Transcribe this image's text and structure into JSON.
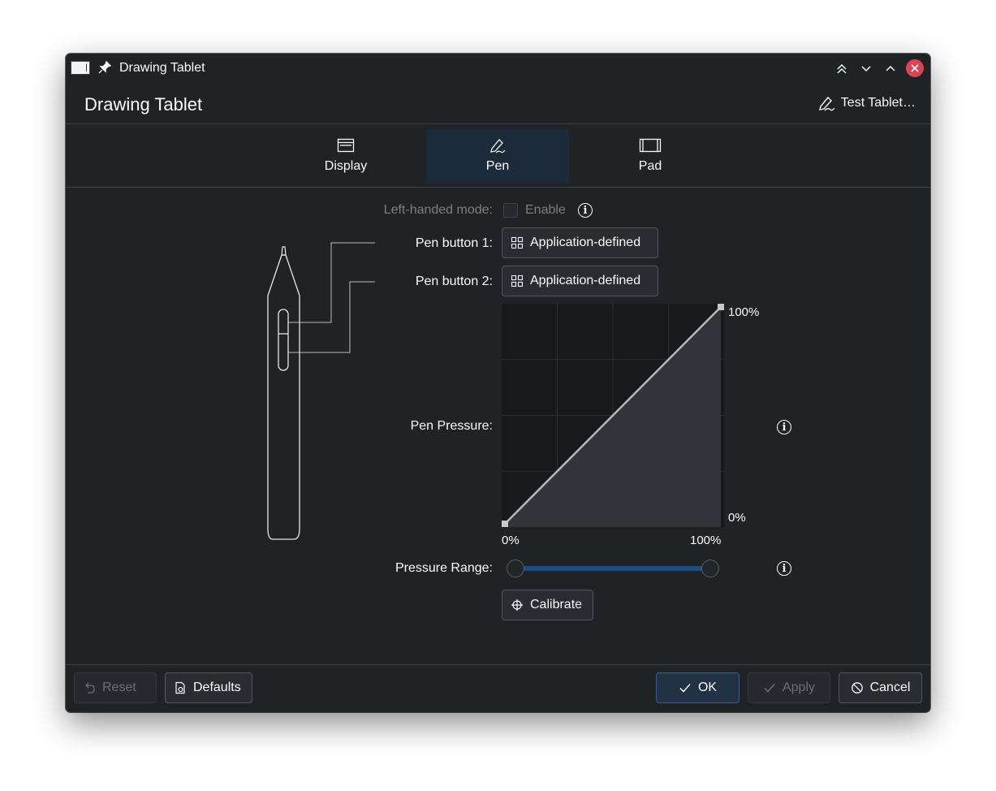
{
  "titlebar": {
    "title": "Drawing Tablet"
  },
  "header": {
    "page_title": "Drawing Tablet",
    "test_button": "Test Tablet…"
  },
  "tabs": [
    {
      "label": "Display",
      "icon": "display-icon"
    },
    {
      "label": "Pen",
      "icon": "pen-icon",
      "active": true
    },
    {
      "label": "Pad",
      "icon": "pad-icon"
    }
  ],
  "pen": {
    "left_handed_label": "Left-handed mode:",
    "left_handed_checkbox": "Enable",
    "button1_label": "Pen button 1:",
    "button1_value": "Application-defined",
    "button2_label": "Pen button 2:",
    "button2_value": "Application-defined",
    "pressure_label": "Pen Pressure:",
    "pressure_curve": {
      "x_min": "0%",
      "x_max": "100%",
      "y_min": "0%",
      "y_max": "100%",
      "points": [
        [
          0,
          0
        ],
        [
          1,
          1
        ]
      ]
    },
    "range_label": "Pressure Range:",
    "range_values": [
      0,
      1
    ],
    "calibrate": "Calibrate"
  },
  "footer": {
    "reset": "Reset",
    "defaults": "Defaults",
    "ok": "OK",
    "apply": "Apply",
    "cancel": "Cancel"
  },
  "colors": {
    "accent": "#1c4a86",
    "close": "#da4453",
    "window_bg": "#202326"
  }
}
